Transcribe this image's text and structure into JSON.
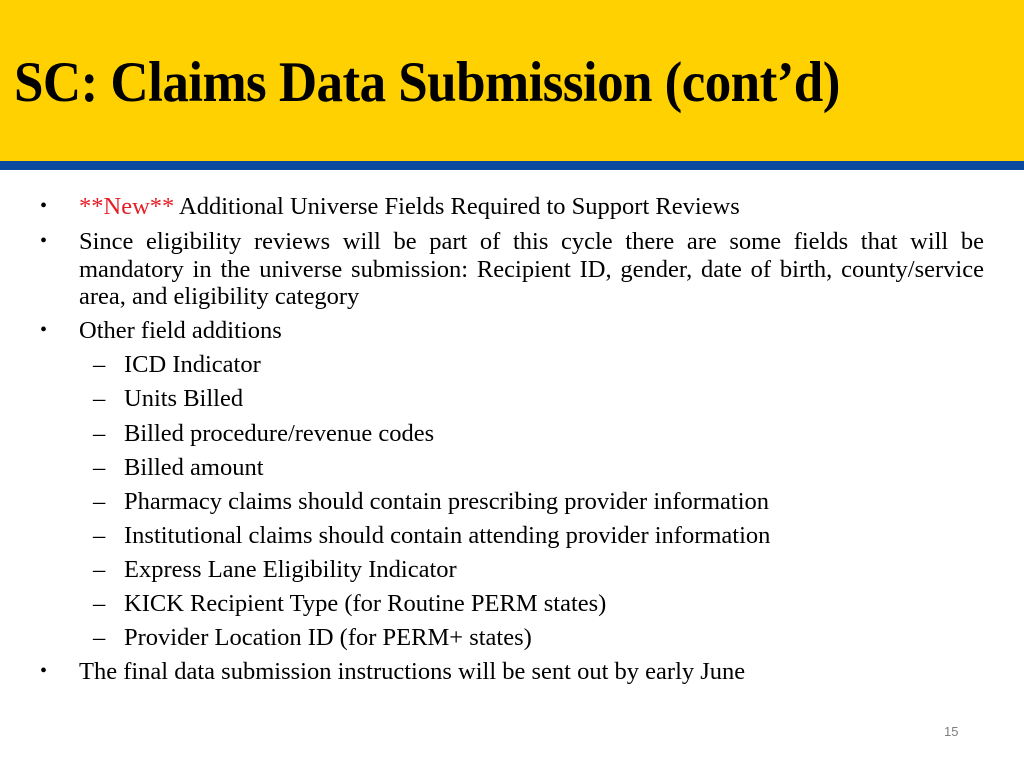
{
  "slide": {
    "title": "SC: Claims Data Submission (cont’d)",
    "colors": {
      "header_bg": "#FFD100",
      "rule": "#0B4A9E",
      "highlight": "#E41E26"
    },
    "bullet_glyph": "•",
    "dash_glyph": "–",
    "bullets": [
      {
        "highlight": "**New**",
        "text": " Additional Universe Fields Required to Support Reviews"
      },
      {
        "text": "Since eligibility reviews will be part of this cycle there are some fields that will be mandatory in the universe submission: Recipient ID, gender, date of birth, county/service area, and eligibility category"
      },
      {
        "text": "Other field additions",
        "subitems": [
          "ICD Indicator",
          "Units Billed",
          "Billed procedure/revenue codes",
          "Billed amount",
          "Pharmacy claims should contain prescribing provider information",
          "Institutional claims should contain attending provider information",
          "Express Lane Eligibility Indicator",
          "KICK Recipient Type (for Routine PERM states)",
          "Provider Location ID (for PERM+ states)"
        ]
      },
      {
        "text": "The final data submission instructions will be sent out by early June"
      }
    ],
    "page_number": "15"
  }
}
